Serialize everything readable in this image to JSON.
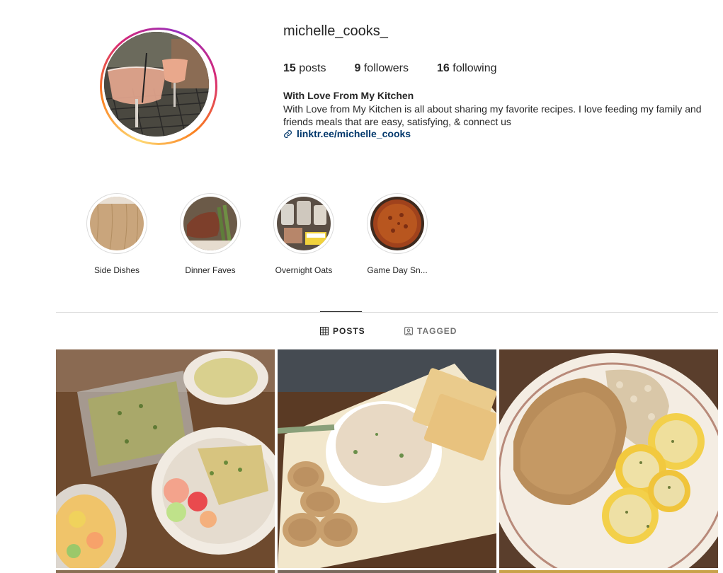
{
  "profile": {
    "username": "michelle_cooks_",
    "stats": {
      "posts_count": "15",
      "posts_label": "posts",
      "followers_count": "9",
      "followers_label": "followers",
      "following_count": "16",
      "following_label": "following"
    },
    "bio_name": "With Love From My Kitchen",
    "bio_text": "With Love from My Kitchen is all about sharing my favorite recipes. I love feeding my family and friends meals that are easy, satisfying, & connect us",
    "bio_link": "linktr.ee/michelle_cooks"
  },
  "highlights": [
    {
      "label": "Side Dishes"
    },
    {
      "label": "Dinner Faves"
    },
    {
      "label": "Overnight Oats"
    },
    {
      "label": "Game Day Sn..."
    }
  ],
  "tabs": {
    "posts": "POSTS",
    "tagged": "TAGGED"
  },
  "icons": {
    "link": "link-icon",
    "grid": "grid-icon",
    "tagged": "tag-portrait-icon"
  },
  "colors": {
    "link": "#00376b",
    "divider": "#dbdbdb",
    "muted": "#737373"
  }
}
